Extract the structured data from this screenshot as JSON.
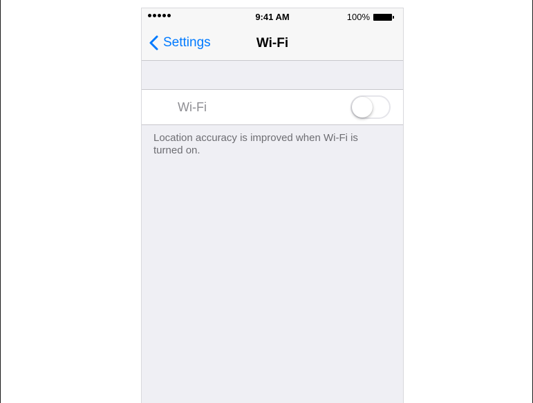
{
  "status_bar": {
    "signal_icon": "signal-dots-icon",
    "time": "9:41 AM",
    "battery_percent": "100%",
    "battery_icon": "battery-full-icon"
  },
  "nav": {
    "back_label": "Settings",
    "back_icon": "chevron-left-icon",
    "title": "Wi-Fi"
  },
  "wifi_row": {
    "label": "Wi-Fi",
    "toggle_state": "off"
  },
  "footer": {
    "note": "Location accuracy is improved when Wi-Fi is turned on."
  },
  "colors": {
    "accent": "#007aff",
    "background": "#efeff4",
    "label_disabled": "#8e8e93",
    "footer_text": "#6d6d72"
  }
}
